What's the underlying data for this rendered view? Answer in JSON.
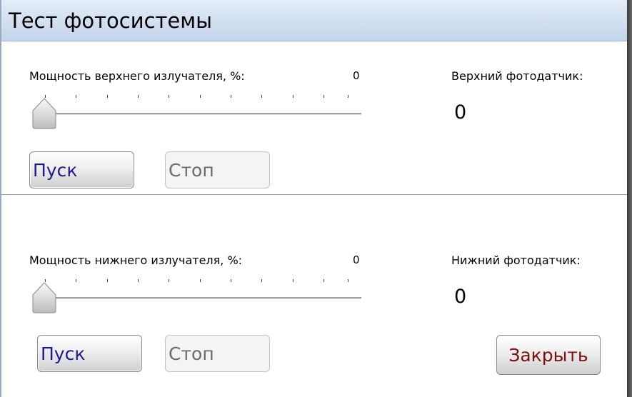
{
  "window": {
    "title": "Тест фотосистемы"
  },
  "upper": {
    "power_label": "Мощность верхнего излучателя, %:",
    "power_value": "0",
    "power_percent": 0,
    "sensor_label": "Верхний фотодатчик:",
    "sensor_value": "0",
    "start_label": "Пуск",
    "stop_label": "Стоп"
  },
  "lower": {
    "power_label": "Мощность нижнего излучателя, %:",
    "power_value": "0",
    "power_percent": 0,
    "sensor_label": "Нижний фотодатчик:",
    "sensor_value": "0",
    "start_label": "Пуск",
    "stop_label": "Стоп"
  },
  "footer": {
    "close_label": "Закрыть"
  },
  "colors": {
    "title_bar": "#c8d8ee",
    "button_text": "#1c1c8c",
    "close_text": "#7a1010"
  }
}
